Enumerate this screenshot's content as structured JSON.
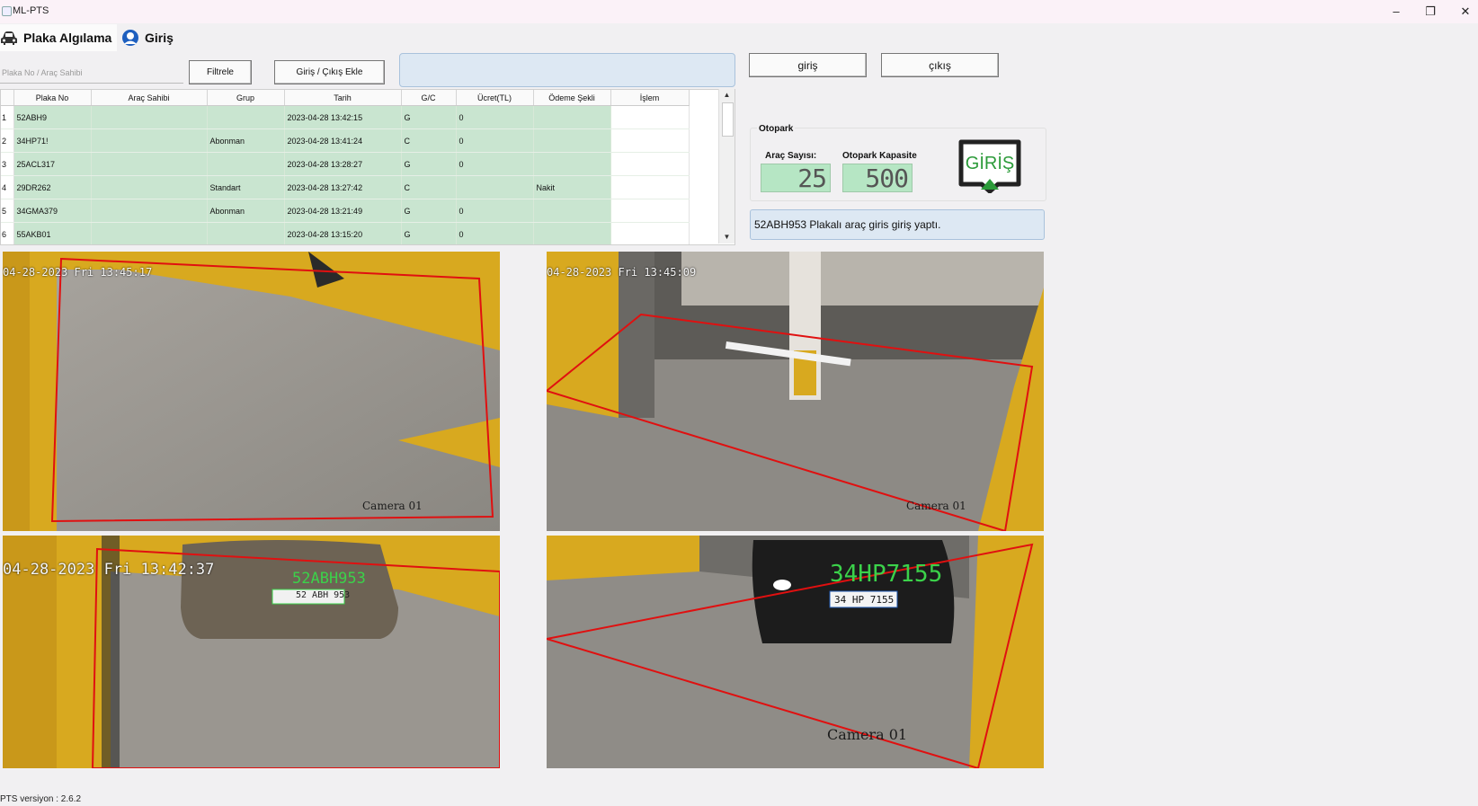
{
  "window": {
    "title": "ML-PTS",
    "controls": [
      "–",
      "❐",
      "✕"
    ]
  },
  "tabs": [
    {
      "label": "Plaka Algılama",
      "icon": "car-icon"
    },
    {
      "label": "Giriş",
      "icon": "user-icon"
    }
  ],
  "toolbar": {
    "search_placeholder": "Plaka No / Araç Sahibi",
    "filter_label": "Filtrele",
    "add_label": "Giriş / Çıkış Ekle"
  },
  "table": {
    "columns": [
      "Plaka No",
      "Araç Sahibi",
      "Grup",
      "Tarih",
      "G/C",
      "Ücret(TL)",
      "Ödeme Şekli",
      "İşlem"
    ],
    "rows": [
      {
        "idx": "1",
        "plaka": "52ABH9",
        "sahip": "",
        "grup": "",
        "tarih": "2023-04-28 13:42:15",
        "gc": "G",
        "ucret": "0",
        "odeme": "",
        "islem": ""
      },
      {
        "idx": "2",
        "plaka": "34HP71!",
        "sahip": "",
        "grup": "Abonman",
        "tarih": "2023-04-28 13:41:24",
        "gc": "C",
        "ucret": "0",
        "odeme": "",
        "islem": ""
      },
      {
        "idx": "3",
        "plaka": "25ACL317",
        "sahip": "",
        "grup": "",
        "tarih": "2023-04-28 13:28:27",
        "gc": "G",
        "ucret": "0",
        "odeme": "",
        "islem": ""
      },
      {
        "idx": "4",
        "plaka": "29DR262",
        "sahip": "",
        "grup": "Standart",
        "tarih": "2023-04-28 13:27:42",
        "gc": "C",
        "ucret": "",
        "odeme": "Nakit",
        "islem": ""
      },
      {
        "idx": "5",
        "plaka": "34GMA379",
        "sahip": "",
        "grup": "Abonman",
        "tarih": "2023-04-28 13:21:49",
        "gc": "G",
        "ucret": "0",
        "odeme": "",
        "islem": ""
      },
      {
        "idx": "6",
        "plaka": "55AKB01",
        "sahip": "",
        "grup": "",
        "tarih": "2023-04-28 13:15:20",
        "gc": "G",
        "ucret": "0",
        "odeme": "",
        "islem": ""
      }
    ]
  },
  "controls": {
    "giris_label": "giriş",
    "cikis_label": "çıkış"
  },
  "otopark": {
    "title": "Otopark",
    "count_label": "Araç Sayısı:",
    "count_value": "25",
    "capacity_label": "Otopark Kapasite",
    "capacity_value": "500",
    "icon_text": "GİRİŞ"
  },
  "status_message": "52ABH953 Plakalı araç giris giriş yaptı.",
  "cameras": [
    {
      "timestamp": "04-28-2023 Fri 13:45:17",
      "label": "Camera 01",
      "plate": ""
    },
    {
      "timestamp": "04-28-2023 Fri 13:45:09",
      "label": "Camera 01",
      "plate": ""
    },
    {
      "timestamp": "04-28-2023 Fri 13:42:37",
      "label": "",
      "plate": "52ABH953",
      "plate_sign": "52 ABH 953"
    },
    {
      "timestamp": "",
      "label": "Camera 01",
      "plate": "34HP7155",
      "plate_sign": "34 HP 7155"
    }
  ],
  "footer": {
    "version": "PTS versiyon : 2.6.2"
  },
  "colors": {
    "row_green": "#c9e5d0",
    "lcd_green": "#b6e6c4",
    "info_blue": "#dde8f3",
    "giris_green": "#2c9b3a",
    "roi_red": "#e01010"
  }
}
